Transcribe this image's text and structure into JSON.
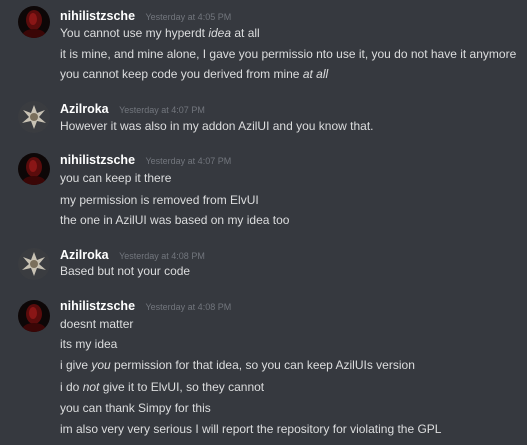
{
  "colors": {
    "background": "#36393f",
    "username": "#ffffff",
    "timestamp": "#72767d",
    "message_text": "#dcddde"
  },
  "messages": [
    {
      "author": "nihilistzsche",
      "avatar_icon": "dark-red-portrait-avatar-icon",
      "timestamp": "Yesterday at 4:05 PM",
      "lines": [
        {
          "a": "You cannot use my hyperdt ",
          "em": "idea",
          "b": " at all"
        },
        {
          "a": "it is mine, and mine alone, I gave you permissio nto use it, you do not have it anymore",
          "em": "",
          "b": ""
        },
        {
          "a": "you cannot keep code you derived from mine ",
          "em": "at all",
          "b": ""
        }
      ]
    },
    {
      "author": "Azilroka",
      "avatar_icon": "gray-spiky-creature-avatar-icon",
      "timestamp": "Yesterday at 4:07 PM",
      "lines": [
        {
          "a": "However it was also in my addon AzilUI and you know that.",
          "em": "",
          "b": ""
        }
      ]
    },
    {
      "author": "nihilistzsche",
      "avatar_icon": "dark-red-portrait-avatar-icon",
      "timestamp": "Yesterday at 4:07 PM",
      "lines": [
        {
          "a": "you can keep it there",
          "em": "",
          "b": ""
        },
        {
          "a": "my permission is removed from ElvUI",
          "em": "",
          "b": ""
        },
        {
          "a": "the one in AzilUI was based on my idea too",
          "em": "",
          "b": ""
        }
      ]
    },
    {
      "author": "Azilroka",
      "avatar_icon": "gray-spiky-creature-avatar-icon",
      "timestamp": "Yesterday at 4:08 PM",
      "lines": [
        {
          "a": "Based but not your code",
          "em": "",
          "b": ""
        }
      ]
    },
    {
      "author": "nihilistzsche",
      "avatar_icon": "dark-red-portrait-avatar-icon",
      "timestamp": "Yesterday at 4:08 PM",
      "lines": [
        {
          "a": "doesnt matter",
          "em": "",
          "b": ""
        },
        {
          "a": "its my idea",
          "em": "",
          "b": ""
        },
        {
          "a": "i give ",
          "em": "you",
          "b": " permission for that idea, so you can keep AzilUIs version"
        },
        {
          "a": "i do ",
          "em": "not",
          "b": " give it to ElvUI, so they cannot"
        },
        {
          "a": "you can thank Simpy for this",
          "em": "",
          "b": ""
        },
        {
          "a": "im also very very serious I will report the repository for violating the GPL",
          "em": "",
          "b": ""
        }
      ]
    }
  ]
}
